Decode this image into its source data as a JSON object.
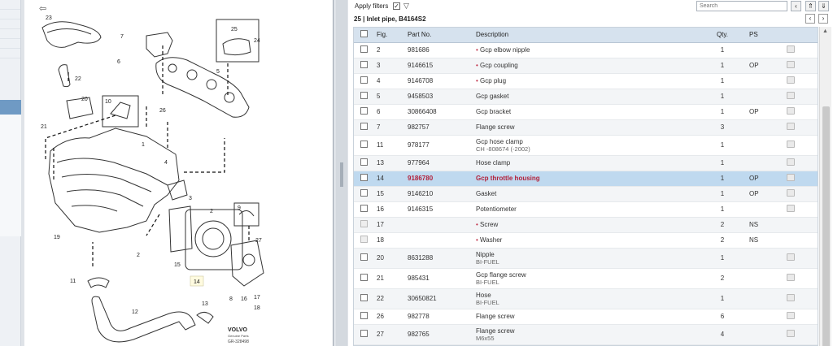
{
  "filters": {
    "apply_label": "Apply filters",
    "checked_mark": "✓",
    "search_placeholder": "Search"
  },
  "assembly": {
    "number": "25",
    "separator": "|",
    "title": "Inlet pipe, B4164S2"
  },
  "columns": {
    "fig": "Fig.",
    "part": "Part No.",
    "desc": "Description",
    "qty": "Qty.",
    "ps": "PS"
  },
  "rows": [
    {
      "fig": "2",
      "part": "981686",
      "bullet": "•",
      "desc": "Gcp elbow nipple",
      "sub": "",
      "qty": "1",
      "ps": ""
    },
    {
      "fig": "3",
      "part": "9146615",
      "bullet": "•",
      "desc": "Gcp coupling",
      "sub": "",
      "qty": "1",
      "ps": "OP"
    },
    {
      "fig": "4",
      "part": "9146708",
      "bullet": "•",
      "desc": "Gcp plug",
      "sub": "",
      "qty": "1",
      "ps": ""
    },
    {
      "fig": "5",
      "part": "9458503",
      "bullet": "",
      "desc": "Gcp gasket",
      "sub": "",
      "qty": "1",
      "ps": ""
    },
    {
      "fig": "6",
      "part": "30866408",
      "bullet": "",
      "desc": "Gcp bracket",
      "sub": "",
      "qty": "1",
      "ps": "OP"
    },
    {
      "fig": "7",
      "part": "982757",
      "bullet": "",
      "desc": "Flange screw",
      "sub": "",
      "qty": "3",
      "ps": ""
    },
    {
      "fig": "11",
      "part": "978177",
      "bullet": "",
      "desc": "Gcp hose clamp",
      "sub": "CH -808674 (-2002)",
      "qty": "1",
      "ps": ""
    },
    {
      "fig": "13",
      "part": "977964",
      "bullet": "",
      "desc": "Hose clamp",
      "sub": "",
      "qty": "1",
      "ps": ""
    },
    {
      "fig": "14",
      "part": "9186780",
      "bullet": "",
      "desc": "Gcp throttle housing",
      "sub": "",
      "qty": "1",
      "ps": "OP"
    },
    {
      "fig": "15",
      "part": "9146210",
      "bullet": "",
      "desc": "Gasket",
      "sub": "",
      "qty": "1",
      "ps": "OP"
    },
    {
      "fig": "16",
      "part": "9146315",
      "bullet": "",
      "desc": "Potentiometer",
      "sub": "",
      "qty": "1",
      "ps": ""
    },
    {
      "fig": "17",
      "part": "",
      "bullet": "•",
      "desc": "Screw",
      "sub": "",
      "qty": "2",
      "ps": "NS"
    },
    {
      "fig": "18",
      "part": "",
      "bullet": "•",
      "desc": "Washer",
      "sub": "",
      "qty": "2",
      "ps": "NS"
    },
    {
      "fig": "20",
      "part": "8631288",
      "bullet": "",
      "desc": "Nipple",
      "sub": "BI-FUEL",
      "qty": "1",
      "ps": ""
    },
    {
      "fig": "21",
      "part": "985431",
      "bullet": "",
      "desc": "Gcp flange screw",
      "sub": "BI-FUEL",
      "qty": "2",
      "ps": ""
    },
    {
      "fig": "22",
      "part": "30650821",
      "bullet": "",
      "desc": "Hose",
      "sub": "BI-FUEL",
      "qty": "1",
      "ps": ""
    },
    {
      "fig": "26",
      "part": "982778",
      "bullet": "",
      "desc": "Flange screw",
      "sub": "",
      "qty": "6",
      "ps": ""
    },
    {
      "fig": "27",
      "part": "982765",
      "bullet": "",
      "desc": "Flange screw",
      "sub": "M6x55",
      "qty": "4",
      "ps": ""
    }
  ],
  "selected_fig": "14",
  "diagram": {
    "labels": [
      "7",
      "6",
      "5",
      "25",
      "24",
      "23",
      "22",
      "20",
      "21",
      "10",
      "26",
      "4",
      "1",
      "2",
      "3",
      "9",
      "27",
      "19",
      "11",
      "12",
      "13",
      "14",
      "15",
      "8",
      "16",
      "17",
      "18",
      "2"
    ],
    "brand": "VOLVO",
    "brand_sub": "Genuine Parts",
    "code": "GR-328498"
  },
  "icons": {
    "back": "arrow-left-icon",
    "filter": "funnel-icon",
    "clear": "chevron-left-icon",
    "prev": "chevron-left-icon",
    "next": "chevron-right-icon",
    "cart": "add-to-cart-icon"
  },
  "colors": {
    "header": "#d6e2ee",
    "selected_row": "#bfd9ef",
    "accent_red": "#b2203a",
    "sidebar_active": "#6f9ac4"
  }
}
